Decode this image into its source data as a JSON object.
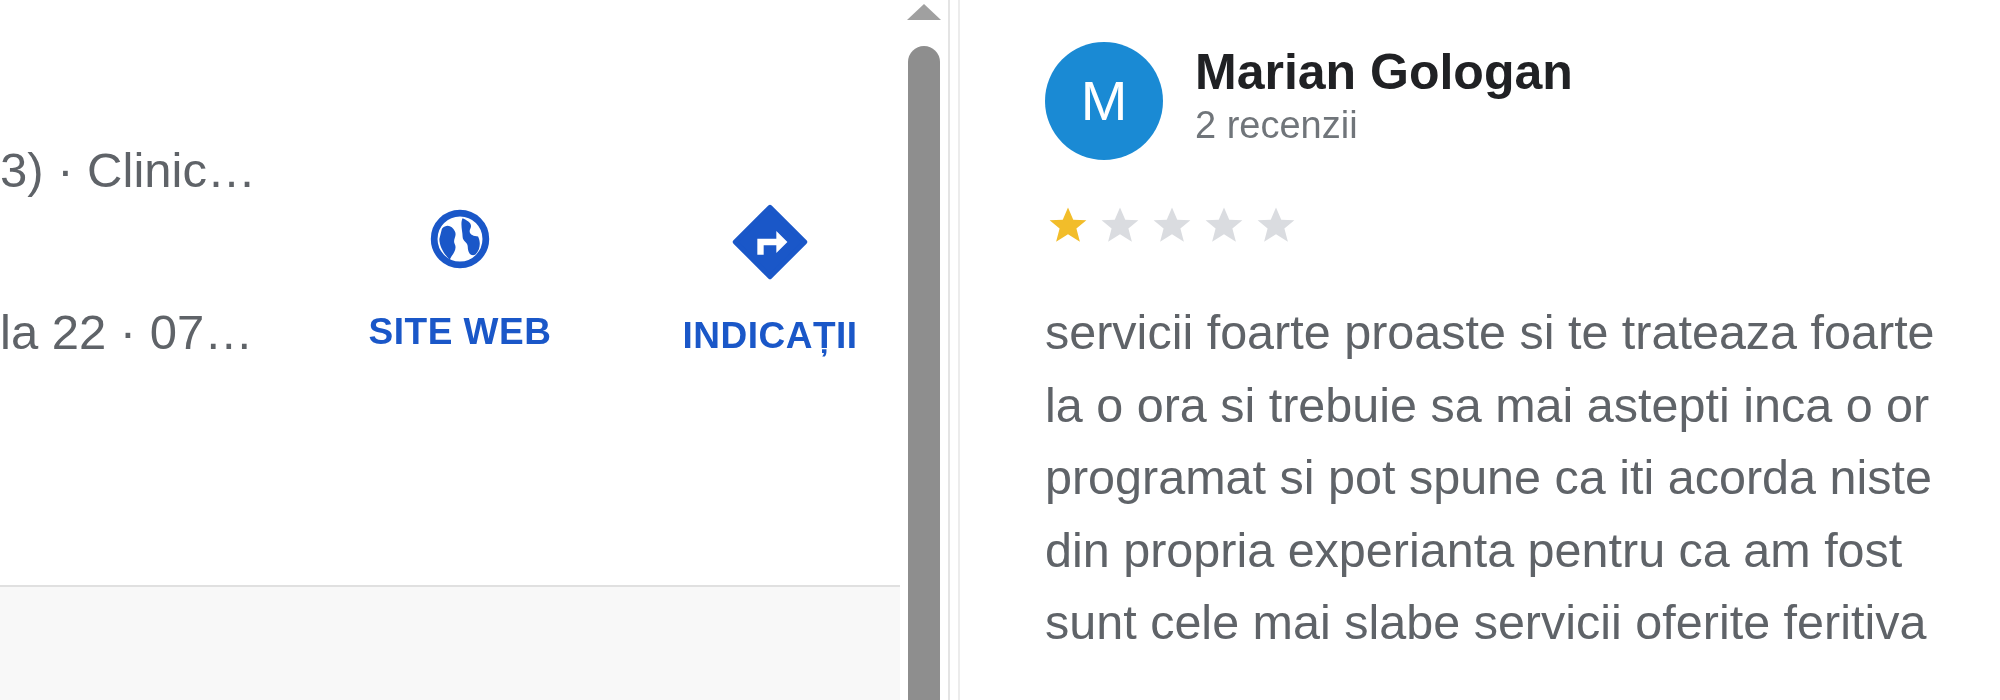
{
  "place": {
    "info_lines": [
      "3) · Clinic…",
      "la 22 · 07…"
    ],
    "actions": [
      {
        "kind": "web",
        "label": "SITE WEB"
      },
      {
        "kind": "directions",
        "label": "INDICAȚII"
      }
    ]
  },
  "review": {
    "avatar_letter": "M",
    "author": "Marian Gologan",
    "reviews_count": "2 recenzii",
    "stars": 1,
    "text_lines": [
      "servicii foarte proaste si te trateaza foarte",
      "la o ora si trebuie sa mai astepti inca o or",
      "programat si pot spune ca iti acorda niste",
      "din propria experianta pentru ca am fost",
      "sunt cele mai slabe servicii oferite feritiva"
    ]
  }
}
